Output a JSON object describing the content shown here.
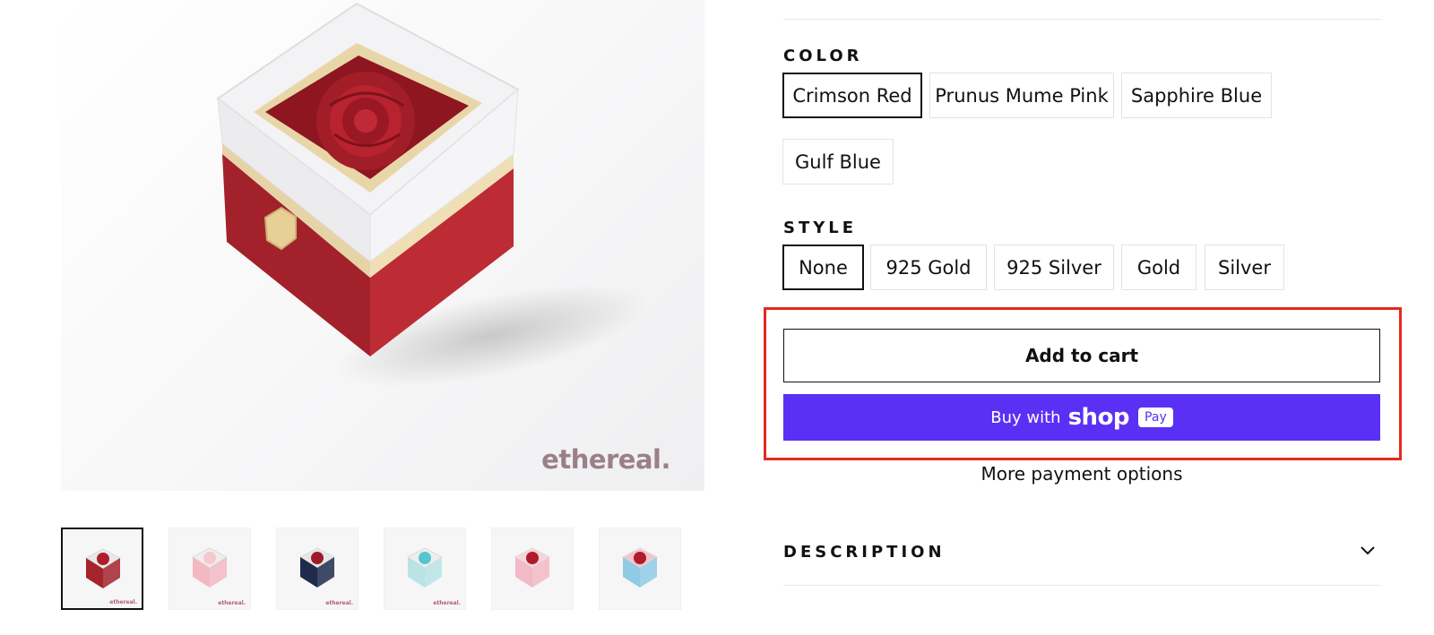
{
  "gallery": {
    "watermark": "ethereal.",
    "thumbnails": [
      {
        "name": "thumb-crimson-red",
        "tag": "ethereal.",
        "box": "#a5232c",
        "rose": "#b01d2a",
        "lid": "#e8e8ea",
        "active": true
      },
      {
        "name": "thumb-pink",
        "tag": "ethereal.",
        "box": "#f2b9c3",
        "rose": "#f7c6cf",
        "lid": "#eeeeee",
        "active": false
      },
      {
        "name": "thumb-navy",
        "tag": "ethereal.",
        "box": "#1e2b4d",
        "rose": "#9e1a2a",
        "lid": "#e6e6e6",
        "active": false
      },
      {
        "name": "thumb-teal",
        "tag": "ethereal.",
        "box": "#b9e3e4",
        "rose": "#55c6cf",
        "lid": "#eeeeee",
        "active": false
      },
      {
        "name": "thumb-group-pink",
        "tag": "",
        "box": "#f3b9c6",
        "rose": "#b01d2a",
        "lid": "#f6d5dc",
        "active": false
      },
      {
        "name": "thumb-group-blue",
        "tag": "",
        "box": "#8fcbe5",
        "rose": "#b01d2a",
        "lid": "#f2c4cf",
        "active": false
      }
    ]
  },
  "color": {
    "label": "COLOR",
    "options": [
      "Crimson Red",
      "Prunus Mume Pink",
      "Sapphire Blue",
      "Gulf Blue"
    ],
    "selected": "Crimson Red"
  },
  "style": {
    "label": "STYLE",
    "options": [
      "None",
      "925 Gold",
      "925 Silver",
      "Gold",
      "Silver"
    ],
    "selected": "None"
  },
  "actions": {
    "add_to_cart": "Add to cart",
    "shop_pay_prefix": "Buy with",
    "shop_pay_brand": "shop",
    "shop_pay_badge": "Pay",
    "more_payment": "More payment options"
  },
  "description": {
    "label": "DESCRIPTION"
  },
  "colors": {
    "shop_pay": "#5a31f4",
    "highlight": "#e5281f",
    "accent": "#111111"
  }
}
